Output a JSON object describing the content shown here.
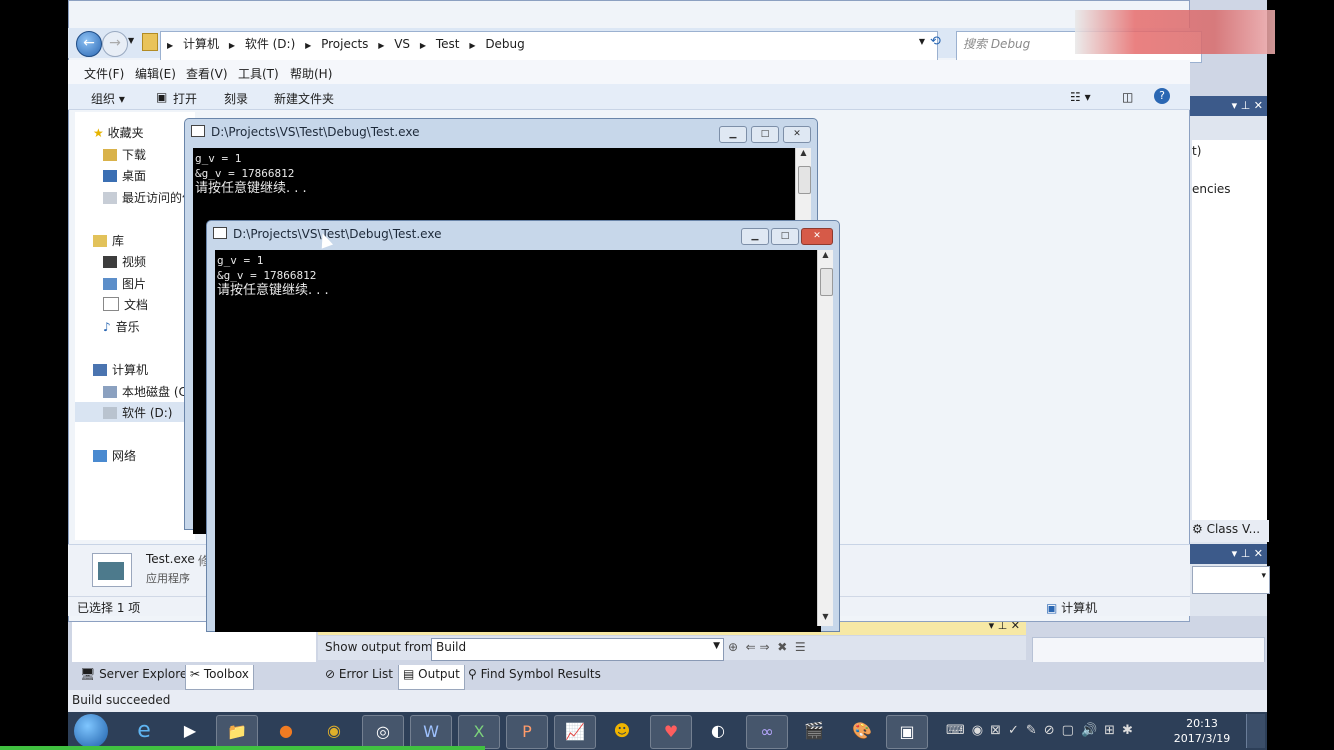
{
  "explorer": {
    "address_parts": [
      "计算机",
      "软件 (D:)",
      "Projects",
      "VS",
      "Test",
      "Debug"
    ],
    "search_placeholder": "搜索 Debug",
    "menu": [
      "文件(F)",
      "编辑(E)",
      "查看(V)",
      "工具(T)",
      "帮助(H)"
    ],
    "commands": [
      "组织 ▾",
      "打开",
      "刻录",
      "新建文件夹"
    ],
    "nav": {
      "favorites": "收藏夹",
      "downloads": "下载",
      "desktop": "桌面",
      "recent": "最近访问的位",
      "libraries": "库",
      "videos": "视频",
      "pictures": "图片",
      "documents": "文档",
      "music": "音乐",
      "computer": "计算机",
      "local_disk": "本地磁盘 (C:",
      "software_disk": "软件 (D:)",
      "network": "网络"
    },
    "detail_name": "Test.exe",
    "detail_extra": "修",
    "detail_type": "应用程序",
    "status_selected": "已选择 1 项",
    "status_location": "计算机"
  },
  "console_back": {
    "title": "D:\\Projects\\VS\\Test\\Debug\\Test.exe",
    "line1": "g_v = 1",
    "line2": "&g_v = 17866812",
    "line3": "请按任意键继续. . ."
  },
  "console_front": {
    "title": "D:\\Projects\\VS\\Test\\Debug\\Test.exe",
    "line1": "g_v = 1",
    "line2": "&g_v = 17866812",
    "line3": "请按任意键继续. . ."
  },
  "vs": {
    "right_text_1": "t)",
    "right_text_2": "encies",
    "class_view_tab": "Class V...",
    "output_label": "Show output from:",
    "output_source": "Build",
    "tabs": [
      "Server Explorer",
      "Toolbox",
      "Error List",
      "Output",
      "Find Symbol Results"
    ],
    "status": "Build succeeded"
  },
  "taskbar": {
    "time": "20:13",
    "date": "2017/3/19"
  },
  "colors": {
    "console_bg": "#000000",
    "titlebar": "#c7d7ea",
    "taskbar": "#2d3f58",
    "close_button": "#d65a48"
  }
}
